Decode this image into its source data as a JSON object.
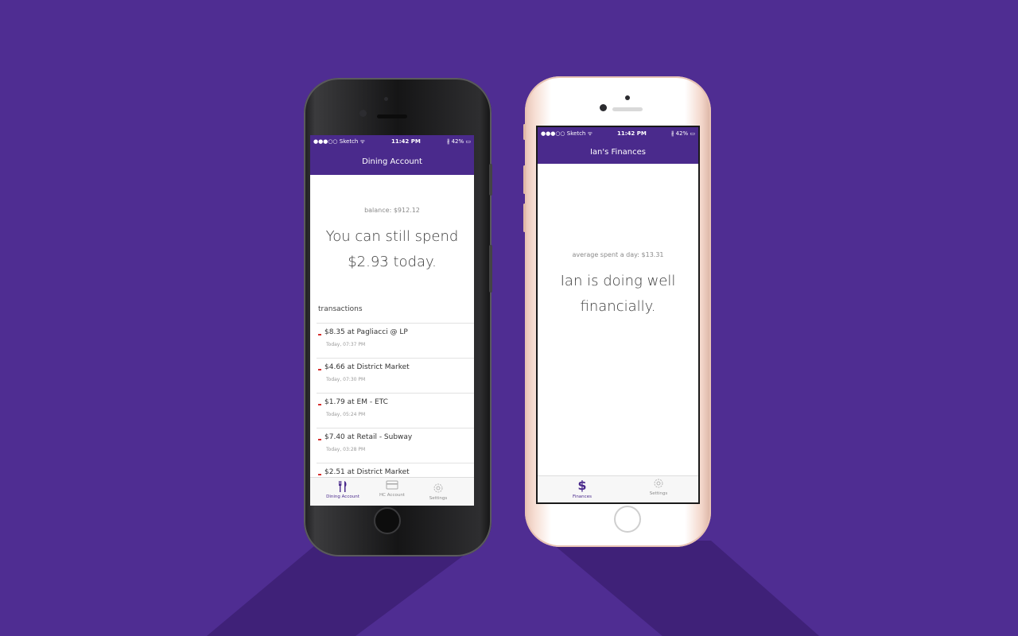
{
  "phone_dining": {
    "status": {
      "carrier": "●●●○○ Sketch ᯤ",
      "time": "11:42 PM",
      "battery": "∦ 42% ▭"
    },
    "nav_title": "Dining Account",
    "balance_label": "balance: $912.12",
    "headline_line1": "You can still spend",
    "headline_line2": "$2.93 today.",
    "transactions_label": "transactions",
    "transactions": [
      {
        "amount": "$8.35 at Pagliacci @ LP",
        "time": "Today, 07:37 PM"
      },
      {
        "amount": "$4.66 at District Market",
        "time": "Today, 07:30 PM"
      },
      {
        "amount": "$1.79 at EM - ETC",
        "time": "Today, 05:24 PM"
      },
      {
        "amount": "$7.40 at Retail - Subway",
        "time": "Today, 03:28 PM"
      },
      {
        "amount": "$2.51 at District Market",
        "time": ""
      }
    ],
    "tabs": [
      {
        "label": "Dining Account",
        "icon": "fork-knife-icon"
      },
      {
        "label": "HC Account",
        "icon": "card-icon"
      },
      {
        "label": "Settings",
        "icon": "gear-icon"
      }
    ]
  },
  "phone_finances": {
    "status": {
      "carrier": "●●●○○ Sketch ᯤ",
      "time": "11:42 PM",
      "battery": "∦ 42% ▭"
    },
    "nav_title": "Ian's Finances",
    "average_label": "average spent a day: $13.31",
    "headline_line1": "Ian is doing well",
    "headline_line2": "financially.",
    "tabs": [
      {
        "label": "Finances",
        "icon": "dollar-icon",
        "glyph": "$"
      },
      {
        "label": "Settings",
        "icon": "gear-icon"
      }
    ]
  },
  "colors": {
    "background": "#4f2d92",
    "accent": "#4a2a8c",
    "debit_marker": "#d6302f"
  }
}
